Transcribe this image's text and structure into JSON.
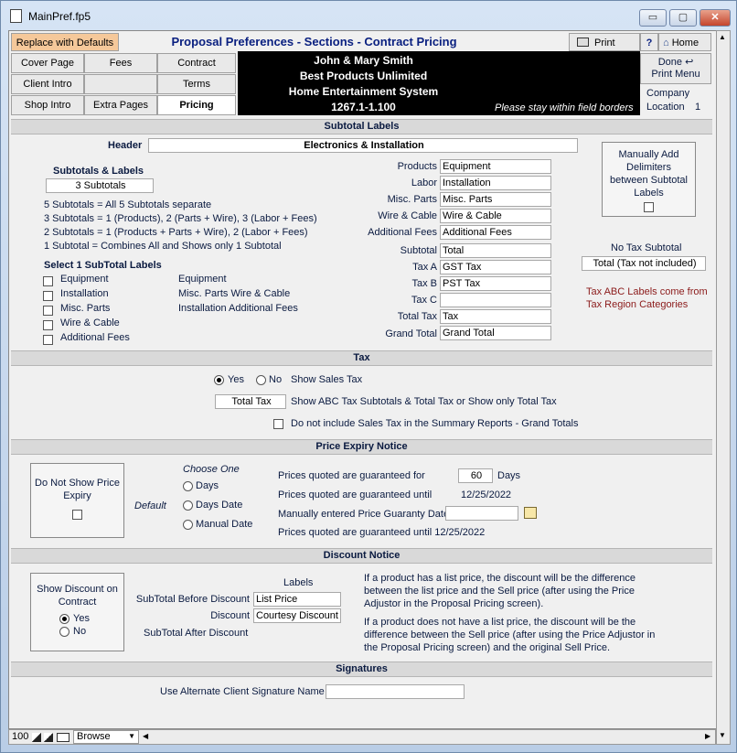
{
  "window": {
    "title": "MainPref.fp5",
    "min": "▭",
    "max": "▢",
    "close": "✕"
  },
  "toolbar": {
    "replace_defaults": "Replace with Defaults",
    "heading": "Proposal Preferences - Sections - Contract Pricing",
    "print": "Print",
    "help": "?",
    "home": "Home",
    "done": "Done",
    "print_menu": "Print Menu"
  },
  "tabs": {
    "cover": "Cover Page",
    "fees": "Fees",
    "contract": "Contract",
    "client_intro": "Client Intro",
    "blank": "",
    "terms": "Terms",
    "shop_intro": "Shop Intro",
    "extra_pages": "Extra Pages",
    "pricing": "Pricing"
  },
  "client": {
    "name": "John & Mary Smith",
    "company": "Best Products Unlimited",
    "system": "Home Entertainment System",
    "number": "1267.1-1.100",
    "note": "Please stay within field borders",
    "company_label": "Company",
    "location_label": "Location",
    "location_value": "1"
  },
  "subtotal_labels": {
    "section": "Subtotal Labels",
    "header_label": "Header",
    "header_value": "Electronics & Installation",
    "subtotals_title": "Subtotals & Labels",
    "subtotals_value": "3 Subtotals",
    "desc": [
      "5  Subtotals = All 5 Subtotals separate",
      "3  Subtotals = 1 (Products),  2 (Parts + Wire),  3 (Labor + Fees)",
      "2  Subtotals = 1 (Products + Parts + Wire),  2 (Labor + Fees)",
      "1  Subtotal   = Combines All and Shows only 1 Subtotal"
    ],
    "select_title": "Select 1 SubTotal Labels",
    "options": [
      "Equipment",
      "Installation",
      "Misc. Parts",
      "Wire & Cable",
      "Additional Fees"
    ],
    "groups": [
      "Equipment",
      "Misc. Parts Wire & Cable",
      "Installation Additional Fees"
    ],
    "field_labels": {
      "products": "Products",
      "labor": "Labor",
      "misc": "Misc. Parts",
      "wire": "Wire & Cable",
      "fees": "Additional Fees",
      "subtotal": "Subtotal",
      "taxa": "Tax A",
      "taxb": "Tax B",
      "taxc": "Tax C",
      "total_tax": "Total Tax",
      "grand_total": "Grand Total"
    },
    "field_values": {
      "products": "Equipment",
      "labor": "Installation",
      "misc": "Misc. Parts",
      "wire": "Wire & Cable",
      "fees": "Additional Fees",
      "subtotal": "Total",
      "taxa": "GST Tax",
      "taxb": "PST Tax",
      "taxc": "",
      "total_tax": "Tax",
      "grand_total": "Grand Total"
    },
    "manual_delims": "Manually Add Delimiters between Subtotal Labels",
    "no_tax_title": "No Tax Subtotal",
    "no_tax_value": "Total (Tax not included)",
    "tax_note": "Tax ABC Labels come from Tax Region Categories"
  },
  "tax": {
    "section": "Tax",
    "yes": "Yes",
    "no": "No",
    "show_sales_tax": "Show Sales Tax",
    "total_tax_value": "Total Tax",
    "abc_desc": "Show ABC Tax Subtotals & Total Tax or Show only Total Tax",
    "exclude": "Do not include Sales Tax in the Summary Reports - Grand Totals"
  },
  "expiry": {
    "section": "Price Expiry Notice",
    "do_not_show": "Do Not Show Price Expiry",
    "choose_one": "Choose One",
    "default": "Default",
    "days": "Days",
    "days_date": "Days Date",
    "manual_date": "Manual Date",
    "guaranteed_for": "Prices quoted are guaranteed for",
    "days_value": "60",
    "days_unit": "Days",
    "guaranteed_until": "Prices quoted are guaranteed until",
    "until_value": "12/25/2022",
    "manual_label": "Manually entered Price Guaranty Date",
    "manual_value": "",
    "final": "Prices quoted are guaranteed until 12/25/2022"
  },
  "discount": {
    "section": "Discount Notice",
    "show_discount": "Show Discount on Contract",
    "yes": "Yes",
    "no": "No",
    "labels_title": "Labels",
    "before_label": "SubTotal Before Discount",
    "before_value": "List Price",
    "discount_label": "Discount",
    "discount_value": "Courtesy Discount",
    "after_label": "SubTotal After Discount",
    "note1": "If a product has a list price, the discount will be the difference between the list price and the Sell price (after using the Price Adjustor in the Proposal Pricing screen).",
    "note2": "If a product does not have a list price, the discount will be the difference between the Sell price (after using the Price Adjustor in the Proposal Pricing screen) and the original Sell Price."
  },
  "signatures": {
    "section": "Signatures",
    "alt_label": "Use Alternate Client Signature Name",
    "alt_value": ""
  },
  "status": {
    "zoom": "100",
    "mode": "Browse"
  },
  "colors": {
    "accent_button": "#f5c89a",
    "header_bg": "#000000",
    "section_bg": "#d9d9d9",
    "label_text": "#0a1a40",
    "note_text": "#8b1a1a"
  }
}
